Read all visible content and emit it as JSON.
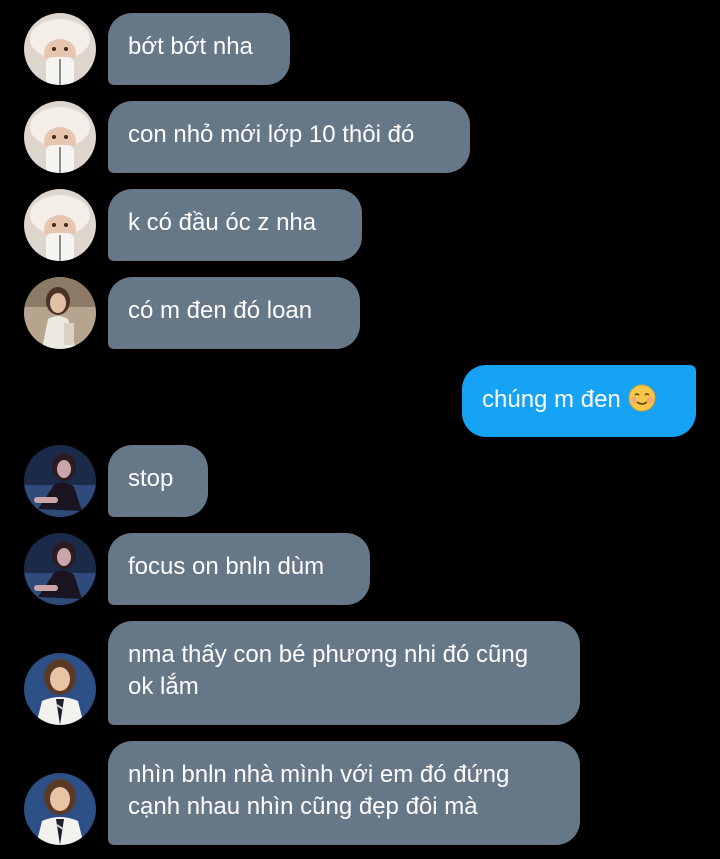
{
  "chat": {
    "messages": [
      {
        "text": "bớt bớt nha"
      },
      {
        "text": "con nhỏ mới lớp 10 thôi đó"
      },
      {
        "text": "k có đầu óc z nha"
      },
      {
        "text": "có m đen đó loan"
      },
      {
        "text": "chúng m đen",
        "emoji": "smiling-face-emoji"
      },
      {
        "text": "stop"
      },
      {
        "text": "focus on bnln dùm"
      },
      {
        "text": "nma thấy con bé phương nhi đó cũng ok lắm"
      },
      {
        "text": "nhìn bnln nhà mình với em đó đứng cạnh nhau nhìn cũng đẹp đôi mà"
      }
    ]
  },
  "colors": {
    "background": "#000000",
    "incoming_bubble": "#667788",
    "outgoing_bubble": "#16a2f5",
    "text": "#ffffff"
  }
}
